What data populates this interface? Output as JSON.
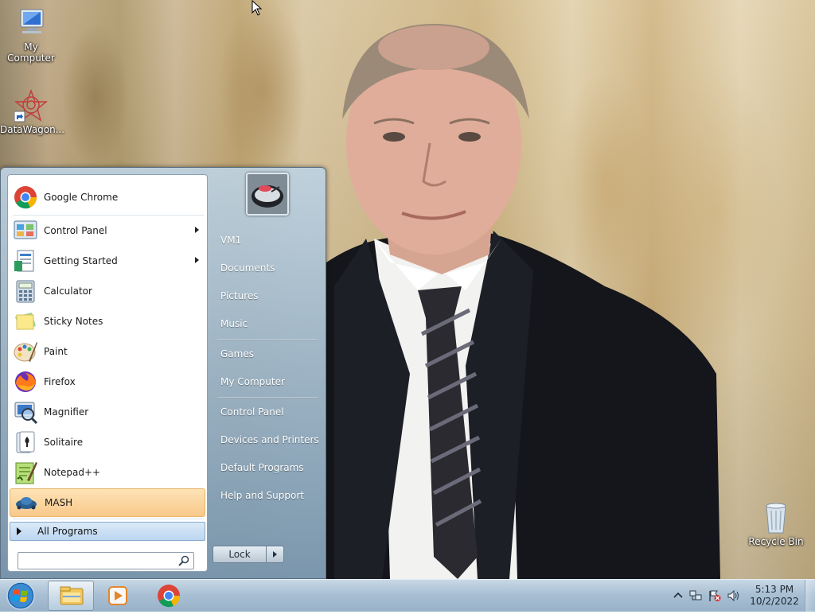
{
  "desktop": {
    "icons": [
      {
        "label": "My Computer",
        "icon": "computer-icon"
      },
      {
        "label": "DataWagon...",
        "icon": "datawagon-shortcut-icon"
      },
      {
        "label": "Recycle Bin",
        "icon": "recycle-bin-icon"
      }
    ]
  },
  "start_menu": {
    "programs": [
      {
        "label": "Google Chrome",
        "icon": "chrome-icon",
        "submenu": false
      },
      {
        "label": "Control Panel",
        "icon": "control-panel-icon",
        "submenu": true
      },
      {
        "label": "Getting Started",
        "icon": "getting-started-icon",
        "submenu": true
      },
      {
        "label": "Calculator",
        "icon": "calculator-icon",
        "submenu": false
      },
      {
        "label": "Sticky Notes",
        "icon": "sticky-notes-icon",
        "submenu": false
      },
      {
        "label": "Paint",
        "icon": "paint-icon",
        "submenu": false
      },
      {
        "label": "Firefox",
        "icon": "firefox-icon",
        "submenu": false
      },
      {
        "label": "Magnifier",
        "icon": "magnifier-icon",
        "submenu": false
      },
      {
        "label": "Solitaire",
        "icon": "solitaire-icon",
        "submenu": false
      },
      {
        "label": "Notepad++",
        "icon": "notepadpp-icon",
        "submenu": false
      },
      {
        "label": "MASH",
        "icon": "mash-icon",
        "submenu": false,
        "highlighted": true
      }
    ],
    "all_programs": "All Programs",
    "search_placeholder": "",
    "right_links": [
      {
        "label": "VM1"
      },
      {
        "label": "Documents"
      },
      {
        "label": "Pictures"
      },
      {
        "label": "Music"
      },
      {
        "label": "Games"
      },
      {
        "label": "My Computer"
      },
      {
        "label": "Control Panel"
      },
      {
        "label": "Devices and Printers"
      },
      {
        "label": "Default Programs"
      },
      {
        "label": "Help and Support"
      }
    ],
    "lock_label": "Lock"
  },
  "taskbar": {
    "pinned": [
      {
        "icon": "windows-explorer-icon",
        "active": true
      },
      {
        "icon": "media-player-icon",
        "active": false
      },
      {
        "icon": "chrome-icon",
        "active": false
      }
    ],
    "tray_icons": [
      "show-hidden-icons-chevron",
      "network-icon",
      "action-center-flag-icon",
      "volume-icon"
    ],
    "time": "5:13 PM",
    "date": "10/2/2022"
  },
  "colors": {
    "highlight": "#f8c98a",
    "taskbar": "#a9c0d4",
    "start_menu_right": "#8fa8be"
  }
}
